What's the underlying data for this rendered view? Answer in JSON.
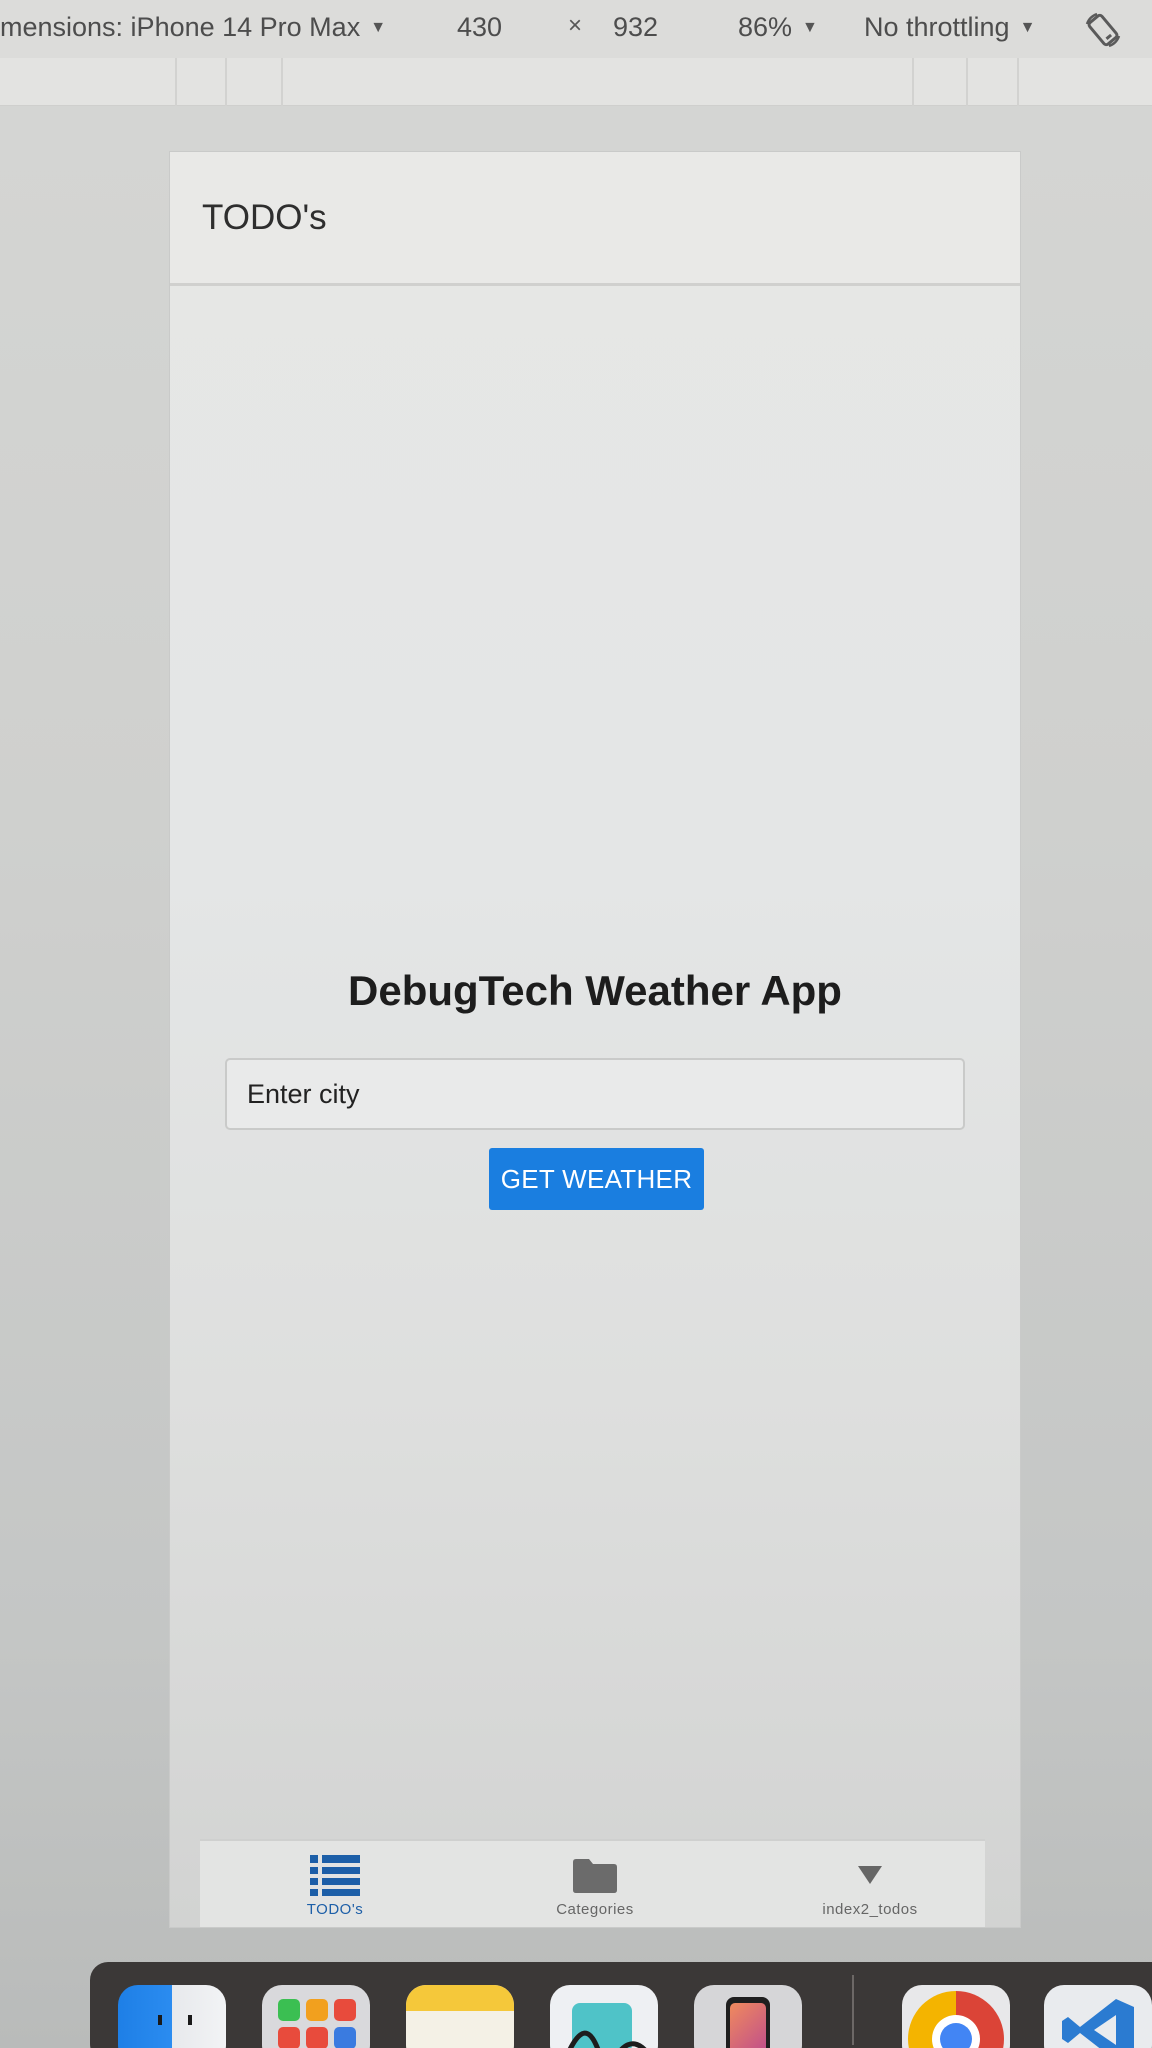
{
  "devtools": {
    "dimensions_label": "mensions: iPhone 14 Pro Max",
    "width": "430",
    "times": "×",
    "height": "932",
    "zoom": "86%",
    "throttling": "No throttling"
  },
  "app": {
    "header_title": "TODO's",
    "weather_title": "DebugTech Weather App",
    "city_placeholder": "Enter city",
    "button_label": "GET WEATHER"
  },
  "tabs": [
    {
      "label": "TODO's",
      "icon": "list-icon",
      "active": true
    },
    {
      "label": "Categories",
      "icon": "folder-icon",
      "active": false
    },
    {
      "label": "index2_todos",
      "icon": "triangle-down-icon",
      "active": false
    }
  ],
  "colors": {
    "button_blue": "#1a7ee0",
    "active_tab": "#1d5fa8"
  },
  "dock": {
    "icons": [
      "finder-icon",
      "launchpad-icon",
      "notes-icon",
      "freeform-icon",
      "iphone-mirroring-icon",
      "chrome-icon",
      "vscode-icon"
    ]
  }
}
